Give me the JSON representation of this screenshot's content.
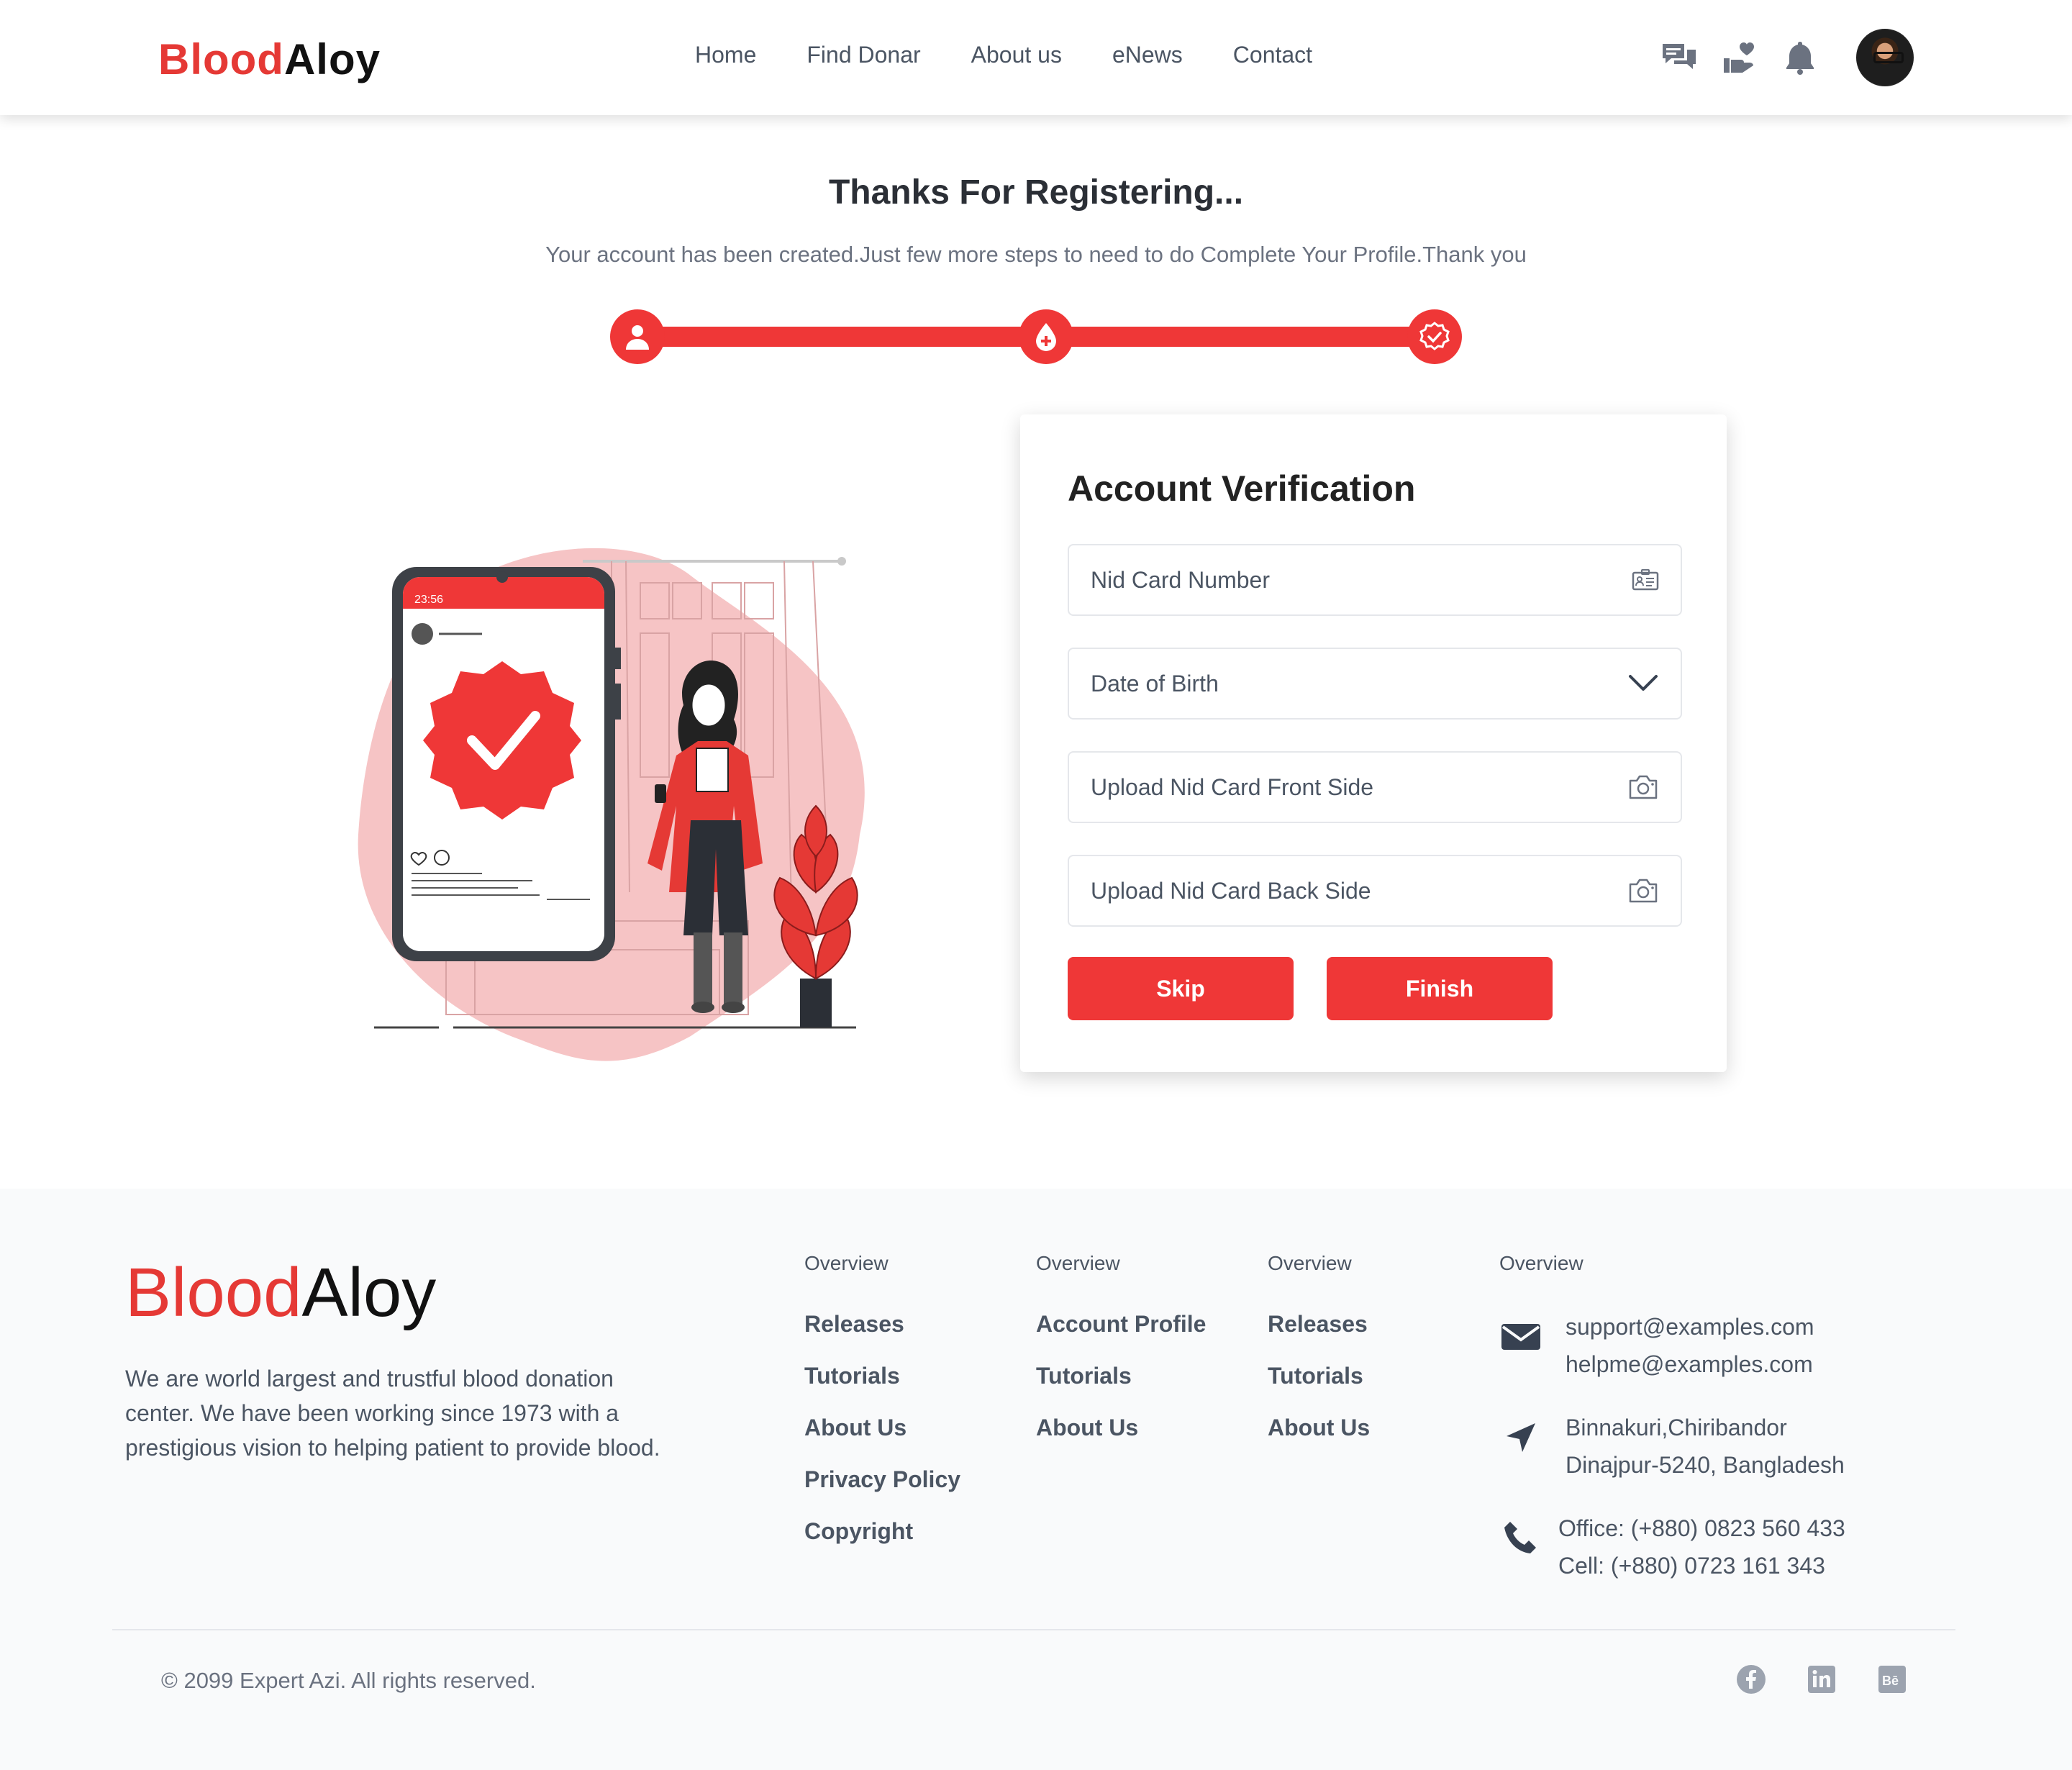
{
  "header": {
    "logo_part1": "Blood",
    "logo_part2": "Aloy",
    "nav": [
      "Home",
      "Find Donar",
      "About us",
      "eNews",
      "Contact"
    ],
    "icons": [
      "chat-icon",
      "donate-hand-icon",
      "bell-icon"
    ]
  },
  "intro": {
    "title": "Thanks For Registering...",
    "subtitle": "Your account has been created.Just few more steps to need to do Complete Your Profile.Thank you"
  },
  "progress": {
    "steps": [
      "user-icon",
      "blood-drop-icon",
      "verified-badge-icon"
    ],
    "completed_fraction": 1.0
  },
  "illustration": {
    "phone_time": "23:56"
  },
  "card": {
    "title": "Account Verification",
    "fields": {
      "nid": "Nid Card Number",
      "dob": "Date of Birth",
      "front": "Upload Nid Card Front Side",
      "back": "Upload Nid Card Back Side"
    },
    "skip_label": "Skip",
    "finish_label": "Finish"
  },
  "footer": {
    "logo_part1": "Blood",
    "logo_part2": "Aloy",
    "description": "We are world largest and trustful blood donation center. We have been working since 1973 with a prestigious vision to helping patient to provide blood.",
    "columns": [
      {
        "heading": "Overview",
        "links": [
          "Releases",
          "Tutorials",
          "About Us",
          "Privacy Policy",
          "Copyright"
        ]
      },
      {
        "heading": "Overview",
        "links": [
          "Account Profile",
          "Tutorials",
          "About Us"
        ]
      },
      {
        "heading": "Overview",
        "links": [
          "Releases",
          "Tutorials",
          "About Us"
        ]
      }
    ],
    "contact": {
      "heading": "Overview",
      "email1": "support@examples.com",
      "email2": "helpme@examples.com",
      "address1": "Binnakuri,Chiribandor",
      "address2": "Dinajpur-5240, Bangladesh",
      "office": "Office: (+880) 0823 560 433",
      "cell": "Cell: (+880) 0723 161 343"
    },
    "copyright": "© 2099 Expert Azi. All rights reserved.",
    "socials": [
      "facebook-icon",
      "linkedin-icon",
      "behance-icon"
    ]
  },
  "colors": {
    "brand_red": "#ef3737",
    "text_gray": "#4b5563",
    "footer_bg": "#f9fafb"
  }
}
